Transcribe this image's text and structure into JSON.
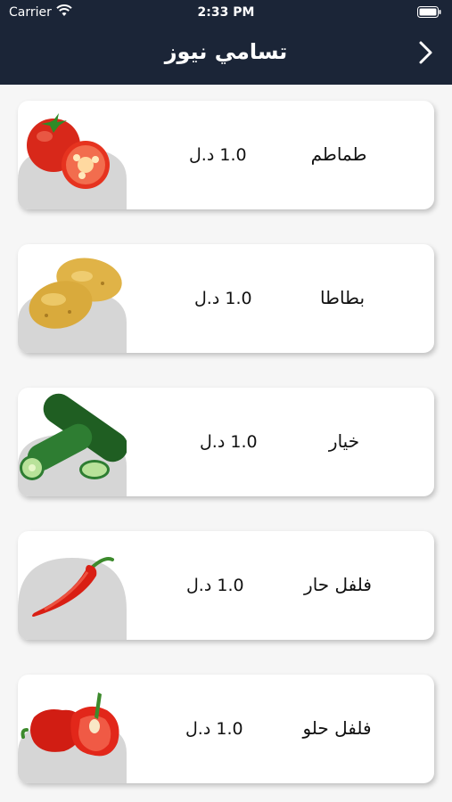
{
  "status_bar": {
    "carrier": "Carrier",
    "time": "2:33 PM"
  },
  "header": {
    "title": "تسامي نيوز",
    "back_icon": "chevron-right-icon"
  },
  "products": [
    {
      "name": "طماطم",
      "price": "1.0 د.ل",
      "image": "tomato-image"
    },
    {
      "name": "بطاطا",
      "price": "1.0 د.ل",
      "image": "potato-image"
    },
    {
      "name": "خيار",
      "price": "1.0 د.ل",
      "image": "cucumber-image"
    },
    {
      "name": "فلفل حار",
      "price": "1.0 د.ل",
      "image": "chili-pepper-image"
    },
    {
      "name": "فلفل حلو",
      "price": "1.0 د.ل",
      "image": "bell-pepper-image"
    }
  ],
  "colors": {
    "header_bg": "#1b2537",
    "page_bg": "#f6f6f6",
    "card_bg": "#ffffff"
  }
}
